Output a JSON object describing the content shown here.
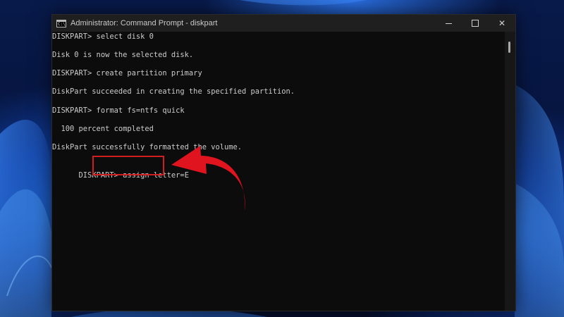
{
  "window": {
    "title": "Administrator: Command Prompt - diskpart",
    "icon_label": "C:\\"
  },
  "console": {
    "lines": [
      "DISKPART> select disk 0",
      "Disk 0 is now the selected disk.",
      "DISKPART> create partition primary",
      "DiskPart succeeded in creating the specified partition.",
      "DISKPART> format fs=ntfs quick",
      "  100 percent completed",
      "DiskPart successfully formatted the volume.",
      "DISKPART> "
    ],
    "current_command": "assign letter=E"
  },
  "annotation": {
    "highlight_color": "#d11f1f",
    "arrow_color": "#e0141e"
  },
  "colors": {
    "console_bg": "#0c0c0c",
    "console_text": "#cccccc",
    "titlebar_bg": "#1f1f1f"
  },
  "icons": {
    "app": "command-prompt-icon",
    "minimize": "minimize-icon",
    "maximize": "maximize-icon",
    "close": "close-icon"
  }
}
